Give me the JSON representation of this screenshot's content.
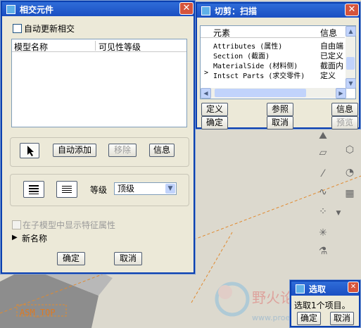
{
  "intersect_dialog": {
    "title": "相交元件",
    "auto_update_label": "自动更新相交",
    "table_headers": [
      "模型名称",
      "可见性等级"
    ],
    "buttons": {
      "auto_add": "自动添加",
      "remove": "移除",
      "info": "信息"
    },
    "level_label": "等级",
    "level_value": "顶级",
    "show_features_label": "在子模型中显示特征属性",
    "new_name_label": "新名称",
    "ok": "确定",
    "cancel": "取消"
  },
  "cut_dialog": {
    "title": "切剪：扫描",
    "headers": [
      "元素",
      "信息"
    ],
    "rows": [
      {
        "element": "Attributes (属性)",
        "info": "自由端"
      },
      {
        "element": "Section (截面)",
        "info": "已定义"
      },
      {
        "element": "MaterialSide (材料侧)",
        "info": "截面内"
      },
      {
        "element": "Intsct Parts (求交零件)",
        "info": "定义"
      }
    ],
    "buttons": {
      "define": "定义",
      "ref": "参照",
      "info": "信息",
      "ok": "确定",
      "cancel": "取消",
      "preview": "预览"
    }
  },
  "select_dialog": {
    "title": "选取",
    "message": "选取1个项目。",
    "ok": "确定",
    "cancel": "取消"
  },
  "scene": {
    "label": "ASM_TOP"
  }
}
